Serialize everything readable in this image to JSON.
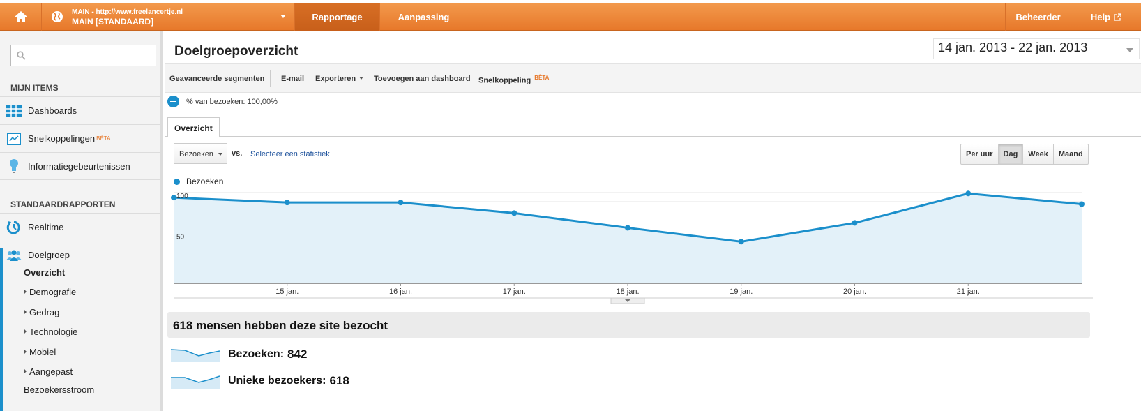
{
  "topbar": {
    "account_url": "MAIN - http://www.freelancertje.nl",
    "account_name": "MAIN [STANDAARD]",
    "tabs": {
      "reporting": "Rapportage",
      "customization": "Aanpassing",
      "admin": "Beheerder",
      "help": "Help"
    },
    "accent_color": "#e7782a"
  },
  "sidebar": {
    "search_placeholder": "",
    "my_items_title": "MIJN ITEMS",
    "my_items": [
      {
        "label": "Dashboards",
        "icon": "grid-icon"
      },
      {
        "label": "Snelkoppelingen",
        "badge": "BÈTA",
        "icon": "shortcut-icon"
      },
      {
        "label": "Informatiegebeurtenissen",
        "icon": "lightbulb-icon"
      }
    ],
    "standard_title": "STANDAARDRAPPORTEN",
    "standard_items": [
      {
        "label": "Realtime",
        "icon": "realtime-icon"
      },
      {
        "label": "Doelgroep",
        "icon": "people-icon"
      }
    ],
    "sub_items": [
      "Overzicht",
      "Demografie",
      "Gedrag",
      "Technologie",
      "Mobiel",
      "Aangepast",
      "Bezoekersstroom"
    ]
  },
  "main": {
    "title": "Doelgroepoverzicht",
    "date_start": "14 jan. 2013",
    "date_sep": "-",
    "date_end": "22 jan. 2013",
    "actions": {
      "segments": "Geavanceerde segmenten",
      "email": "E-mail",
      "export": "Exporteren",
      "dashboard": "Toevoegen aan dashboard",
      "shortcut": "Snelkoppeling",
      "beta": "BÈTA"
    },
    "segment_label": "% van bezoeken: 100,00%",
    "tab_overview": "Overzicht",
    "metric": "Bezoeken",
    "vs": "vs.",
    "select_metric": "Selecteer een statistiek",
    "granularity": [
      "Per uur",
      "Dag",
      "Week",
      "Maand"
    ],
    "granularity_selected": "Dag",
    "summary": "618 mensen hebben deze site bezocht",
    "stats": [
      {
        "label": "Bezoeken:",
        "value": "842"
      },
      {
        "label": "Unieke bezoekers:",
        "value": "618"
      }
    ]
  },
  "chart_data": {
    "type": "area",
    "series": [
      {
        "name": "Bezoeken",
        "values": [
          105,
          99,
          99,
          86,
          68,
          51,
          74,
          110,
          97
        ]
      }
    ],
    "x": [
      "14 jan.",
      "15 jan.",
      "16 jan.",
      "17 jan.",
      "18 jan.",
      "19 jan.",
      "20 jan.",
      "21 jan.",
      "22 jan."
    ],
    "x_tick_labels": [
      "15 jan.",
      "16 jan.",
      "17 jan.",
      "18 jan.",
      "19 jan.",
      "20 jan.",
      "21 jan."
    ],
    "y_tick_labels": [
      "100",
      "50"
    ],
    "ylim": [
      0,
      100
    ],
    "grid": true,
    "legend": "top-left",
    "line_color": "#1b8fcb",
    "fill_color": "#e3f1f9"
  }
}
